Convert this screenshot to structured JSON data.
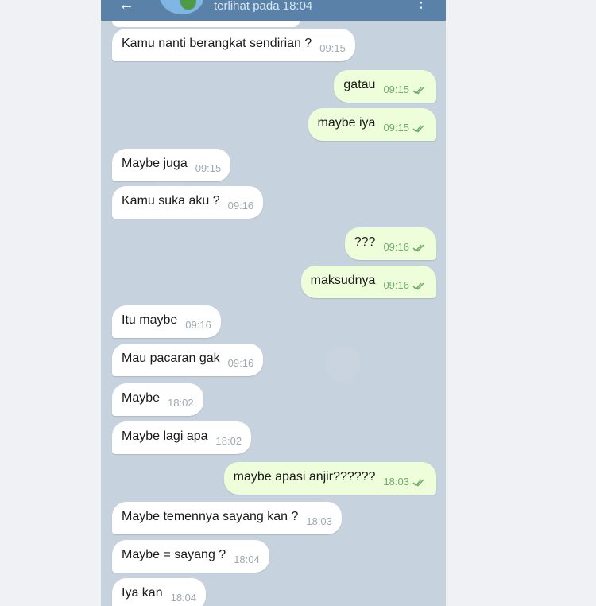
{
  "header": {
    "last_seen": "terlihat pada  18:04"
  },
  "icons": {
    "back": "arrow-left",
    "menu": "vertical-dots",
    "read_receipt": "double-check"
  },
  "colors": {
    "header": "#5a82a8",
    "chat_background": "#c6d2dd",
    "incoming_bubble": "#ffffff",
    "outgoing_bubble": "#eefedb",
    "outgoing_time": "#6fae6a"
  },
  "messages": [
    {
      "dir": "in",
      "text": "Kamu nanti berangkat sendirian ?",
      "time": "09:15"
    },
    {
      "dir": "out",
      "text": "gatau",
      "time": "09:15"
    },
    {
      "dir": "out",
      "text": "maybe iya",
      "time": "09:15"
    },
    {
      "dir": "in",
      "text": "Maybe juga",
      "time": "09:15"
    },
    {
      "dir": "in",
      "text": "Kamu suka aku ?",
      "time": "09:16"
    },
    {
      "dir": "out",
      "text": "???",
      "time": "09:16"
    },
    {
      "dir": "out",
      "text": "maksudnya",
      "time": "09:16"
    },
    {
      "dir": "in",
      "text": "Itu maybe",
      "time": "09:16"
    },
    {
      "dir": "in",
      "text": "Mau pacaran gak",
      "time": "09:16"
    },
    {
      "dir": "in",
      "text": "Maybe",
      "time": "18:02"
    },
    {
      "dir": "in",
      "text": "Maybe lagi apa",
      "time": "18:02"
    },
    {
      "dir": "out",
      "text": "maybe apasi anjir??????",
      "time": "18:03"
    },
    {
      "dir": "in",
      "text": "Maybe temennya sayang kan ?",
      "time": "18:03"
    },
    {
      "dir": "in",
      "text": "Maybe = sayang ?",
      "time": "18:04"
    },
    {
      "dir": "in",
      "text": "Iya kan",
      "time": "18:04"
    }
  ]
}
